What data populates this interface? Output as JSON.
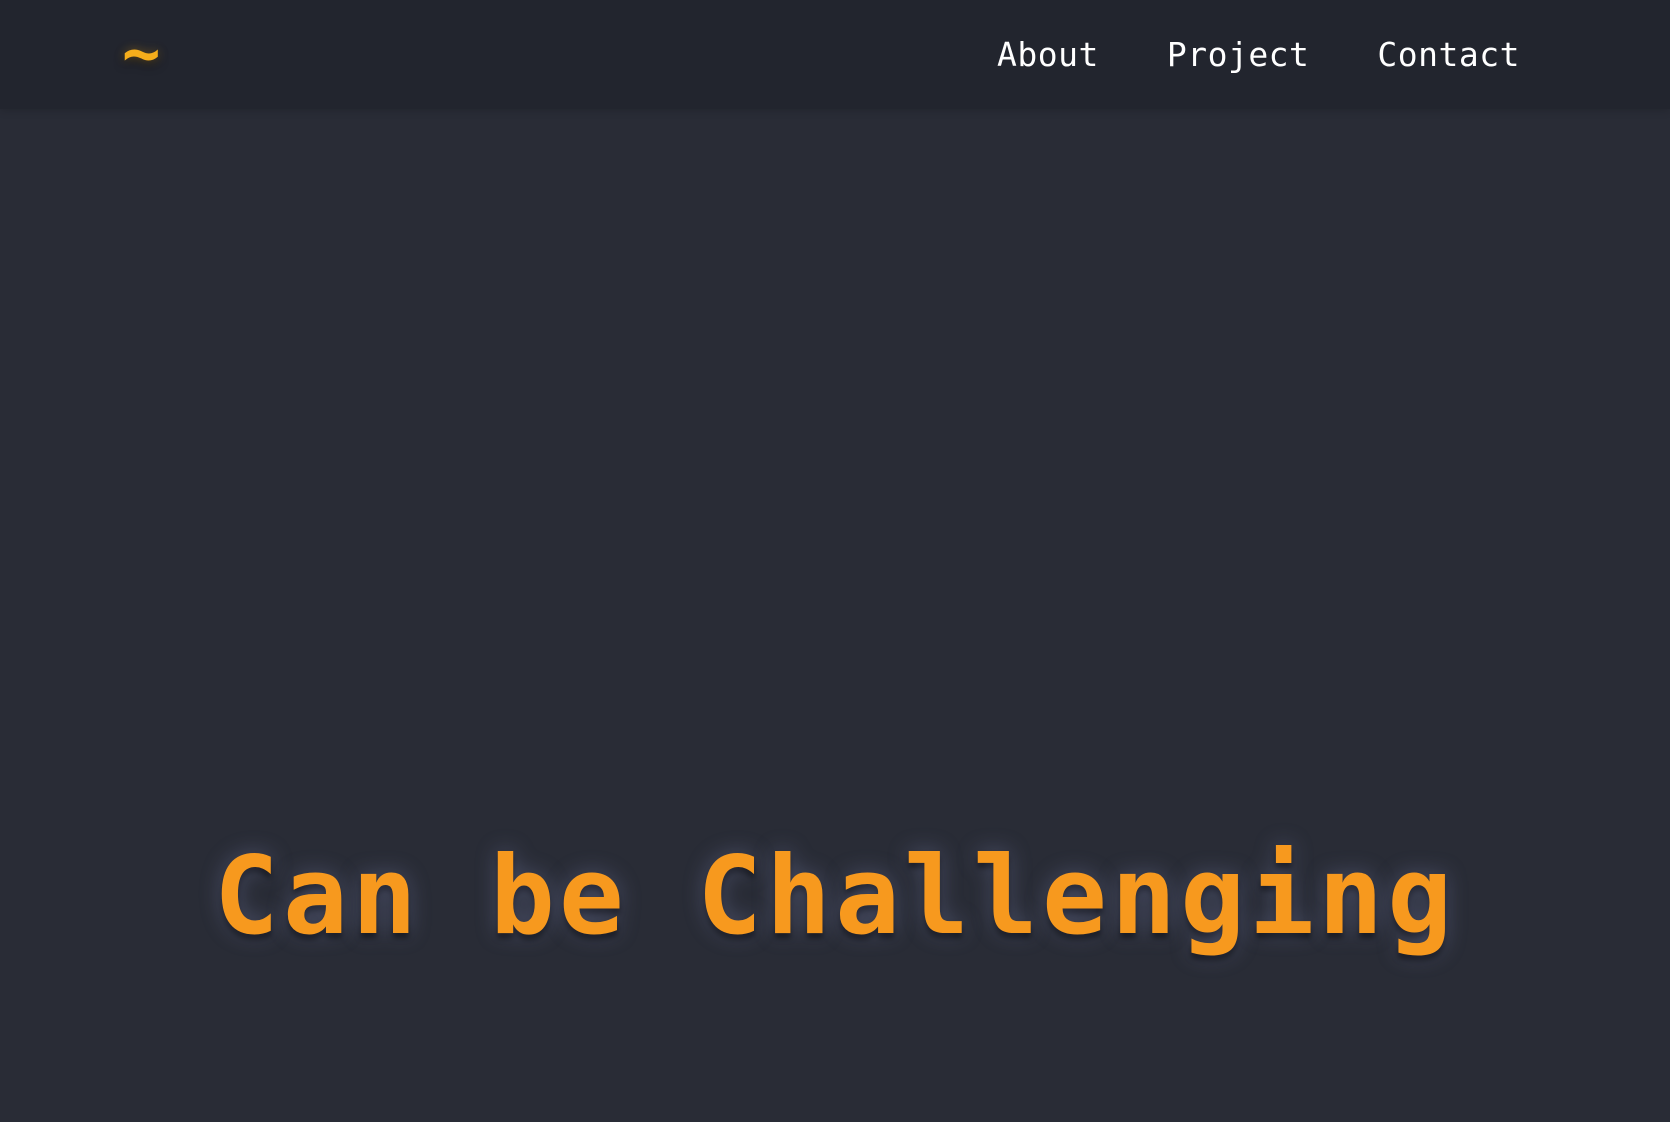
{
  "navbar": {
    "logo": "~",
    "links": [
      {
        "label": "About"
      },
      {
        "label": "Project"
      },
      {
        "label": "Contact"
      }
    ]
  },
  "hero": {
    "headline": "Can be Challenging"
  },
  "colors": {
    "background": "#292c36",
    "navbar": "#22252e",
    "accent_logo": "#f5ad1b",
    "accent_text": "#f7991e",
    "nav_text": "#ffffff"
  }
}
